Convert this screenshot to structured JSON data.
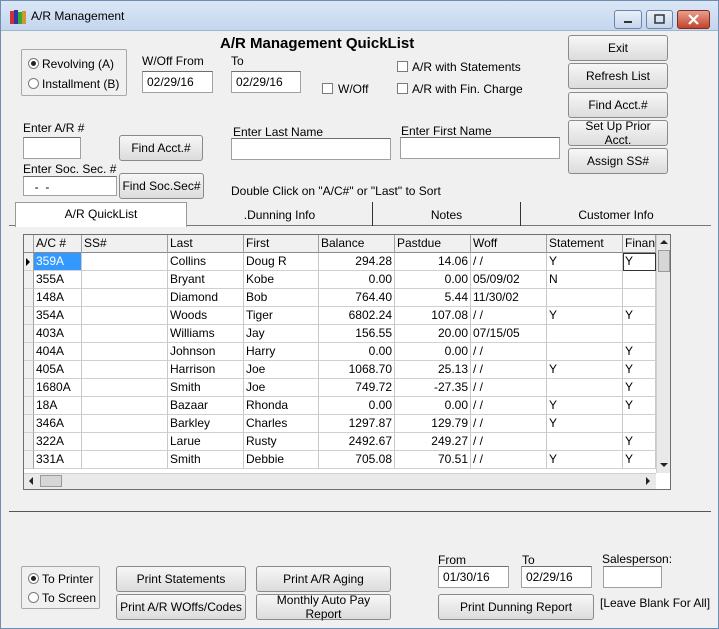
{
  "window": {
    "title": "A/R Management"
  },
  "header": {
    "title": "A/R Management QuickList"
  },
  "mode": {
    "revolving": "Revolving (A)",
    "installment": "Installment (B)",
    "selected": "revolving"
  },
  "woff_range": {
    "from_label": "W/Off From",
    "from": "02/29/16",
    "to_label": "To",
    "to": "02/29/16",
    "woff_label": "W/Off"
  },
  "filters": {
    "statements": "A/R with Statements",
    "fin_charge": "A/R with Fin. Charge"
  },
  "side_buttons": {
    "exit": "Exit",
    "refresh": "Refresh List",
    "find_acct": "Find Acct.#",
    "prior_acct": "Set Up Prior Acct.",
    "assign_ss": "Assign SS#"
  },
  "search": {
    "ar_label": "Enter A/R #",
    "ar_value": "",
    "find_acct": "Find Acct.#",
    "ss_label": "Enter Soc. Sec. #",
    "ss_value": "  -  -",
    "find_ss": "Find Soc.Sec#",
    "last_label": "Enter Last Name",
    "last_value": "",
    "first_label": "Enter First Name",
    "first_value": "",
    "sort_hint": "Double Click on \"A/C#\" or \"Last\" to Sort"
  },
  "tabs": [
    "A/R QuickList",
    ".Dunning Info",
    "Notes",
    "Customer Info"
  ],
  "grid": {
    "columns": [
      "A/C #",
      "SS#",
      "Last",
      "First",
      "Balance",
      "Pastdue",
      "Woff",
      "Statement",
      "Finan"
    ],
    "rows": [
      [
        "359A",
        "",
        "Collins",
        "Doug R",
        "294.28",
        "14.06",
        "/  /",
        "Y",
        "Y"
      ],
      [
        "355A",
        "",
        "Bryant",
        "Kobe",
        "0.00",
        "0.00",
        "05/09/02",
        "N",
        ""
      ],
      [
        "148A",
        "",
        "Diamond",
        "Bob",
        "764.40",
        "5.44",
        "11/30/02",
        "",
        ""
      ],
      [
        "354A",
        "",
        "Woods",
        "Tiger",
        "6802.24",
        "107.08",
        "/  /",
        "Y",
        "Y"
      ],
      [
        "403A",
        "",
        "Williams",
        "Jay",
        "156.55",
        "20.00",
        "07/15/05",
        "",
        ""
      ],
      [
        "404A",
        "",
        "Johnson",
        "Harry",
        "0.00",
        "0.00",
        "/  /",
        "",
        "Y"
      ],
      [
        "405A",
        "",
        "Harrison",
        "Joe",
        "1068.70",
        "25.13",
        "/  /",
        "Y",
        "Y"
      ],
      [
        "1680A",
        "",
        "Smith",
        "Joe",
        "749.72",
        "-27.35",
        "/  /",
        "",
        "Y"
      ],
      [
        "18A",
        "",
        "Bazaar",
        "Rhonda",
        "0.00",
        "0.00",
        "/  /",
        "Y",
        "Y"
      ],
      [
        "346A",
        "",
        "Barkley",
        "Charles",
        "1297.87",
        "129.79",
        "/  /",
        "Y",
        ""
      ],
      [
        "322A",
        "",
        "Larue",
        "Rusty",
        "2492.67",
        "249.27",
        "/  /",
        "",
        "Y"
      ],
      [
        "331A",
        "",
        "Smith",
        "Debbie",
        "705.08",
        "70.51",
        "/  /",
        "Y",
        "Y"
      ]
    ]
  },
  "output": {
    "printer": "To Printer",
    "screen": "To Screen",
    "selected": "printer"
  },
  "reports": {
    "statements": "Print Statements",
    "woffs": "Print A/R WOffs/Codes",
    "aging": "Print A/R Aging",
    "autopay": "Monthly Auto Pay Report",
    "dunning": "Print Dunning Report"
  },
  "report_range": {
    "from_label": "From",
    "from": "01/30/16",
    "to_label": "To",
    "to": "02/29/16"
  },
  "salesperson": {
    "label": "Salesperson:",
    "value": "",
    "hint": "[Leave Blank For All]"
  }
}
